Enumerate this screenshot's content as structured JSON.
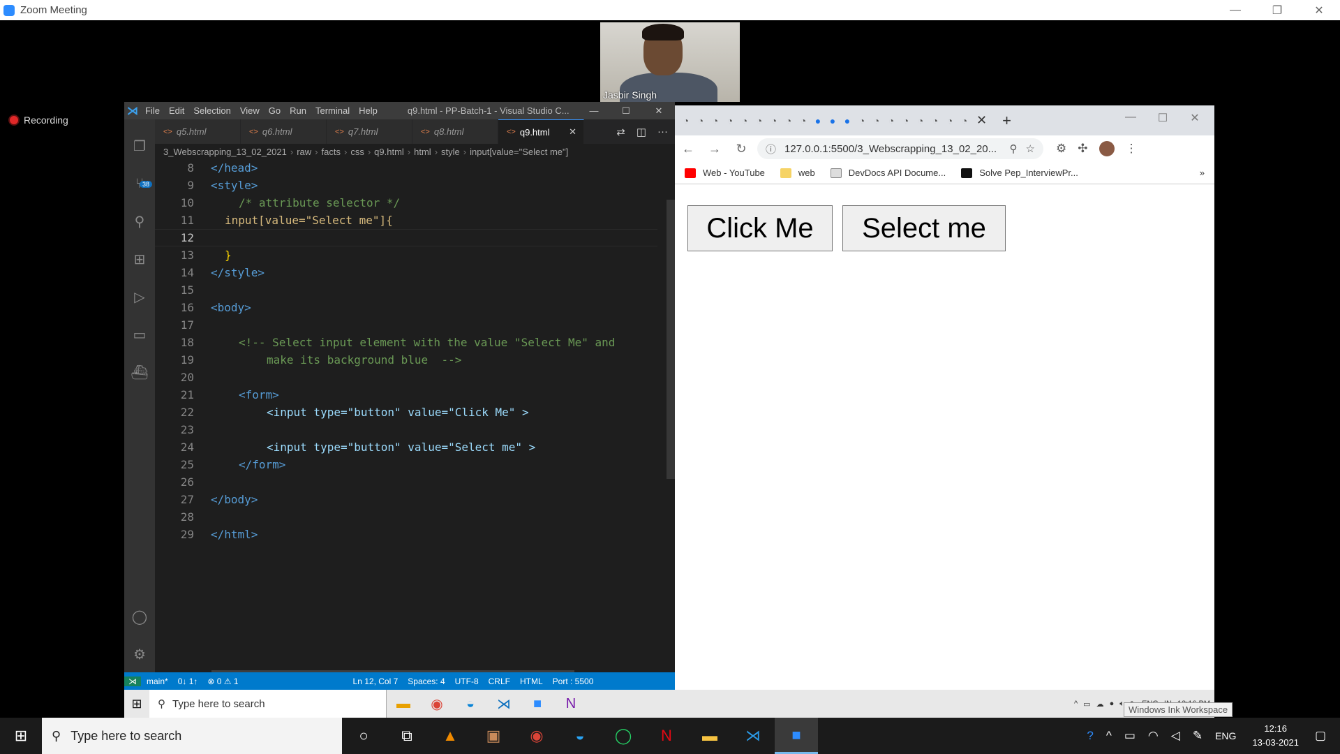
{
  "zoom": {
    "title": "Zoom Meeting",
    "recording_label": "Recording",
    "participant_name": "Jasbir Singh"
  },
  "vscode": {
    "menu": [
      "File",
      "Edit",
      "Selection",
      "View",
      "Go",
      "Run",
      "Terminal",
      "Help"
    ],
    "window_title": "q9.html - PP-Batch-1 - Visual Studio C...",
    "scm_badge": "38",
    "tabs": [
      {
        "label": "q5.html"
      },
      {
        "label": "q6.html"
      },
      {
        "label": "q7.html"
      },
      {
        "label": "q8.html"
      },
      {
        "label": "q9.html"
      }
    ],
    "breadcrumb": [
      "3_Webscrapping_13_02_2021",
      "raw",
      "facts",
      "css",
      "q9.html",
      "html",
      "style",
      "input[value=\"Select me\"]"
    ],
    "code_lines": [
      {
        "n": "8",
        "t": "</head>"
      },
      {
        "n": "9",
        "t": "<style>"
      },
      {
        "n": "10",
        "t": "/* attribute selector */"
      },
      {
        "n": "11",
        "t": "input[value=\"Select me\"]{"
      },
      {
        "n": "12",
        "t": ""
      },
      {
        "n": "13",
        "t": "}"
      },
      {
        "n": "14",
        "t": "</style>"
      },
      {
        "n": "15",
        "t": ""
      },
      {
        "n": "16",
        "t": "<body>"
      },
      {
        "n": "17",
        "t": ""
      },
      {
        "n": "18",
        "t": "<!-- Select input element with the value \"Select Me\" and"
      },
      {
        "n": "19",
        "t": "make its background blue  -->"
      },
      {
        "n": "20",
        "t": ""
      },
      {
        "n": "21",
        "t": "<form>"
      },
      {
        "n": "22",
        "t": "<input type=\"button\" value=\"Click Me\" >"
      },
      {
        "n": "23",
        "t": ""
      },
      {
        "n": "24",
        "t": "<input type=\"button\" value=\"Select me\" >"
      },
      {
        "n": "25",
        "t": "</form>"
      },
      {
        "n": "26",
        "t": ""
      },
      {
        "n": "27",
        "t": "</body>"
      },
      {
        "n": "28",
        "t": ""
      },
      {
        "n": "29",
        "t": "</html>"
      }
    ],
    "status": {
      "branch": "main*",
      "sync": "0↓ 1↑",
      "problems": "⊗ 0 ⚠ 1",
      "position": "Ln 12, Col 7",
      "spaces": "Spaces: 4",
      "encoding": "UTF-8",
      "eol": "CRLF",
      "language": "HTML",
      "port": "Port : 5500"
    }
  },
  "chrome": {
    "url": "127.0.0.1:5500/3_Webscrapping_13_02_20...",
    "bookmarks": [
      "Web - YouTube",
      "web",
      "DevDocs API Docume...",
      "Solve Pep_InterviewPr..."
    ],
    "buttons": [
      "Click Me",
      "Select me"
    ]
  },
  "inner_taskbar": {
    "search_placeholder": "Type here to search",
    "lang": "ENG",
    "region": "IN",
    "time": "12:16 PM",
    "tooltip": "Windows Ink Workspace"
  },
  "taskbar": {
    "search_placeholder": "Type here to search",
    "lang": "ENG",
    "time": "12:16",
    "date": "13-03-2021"
  }
}
